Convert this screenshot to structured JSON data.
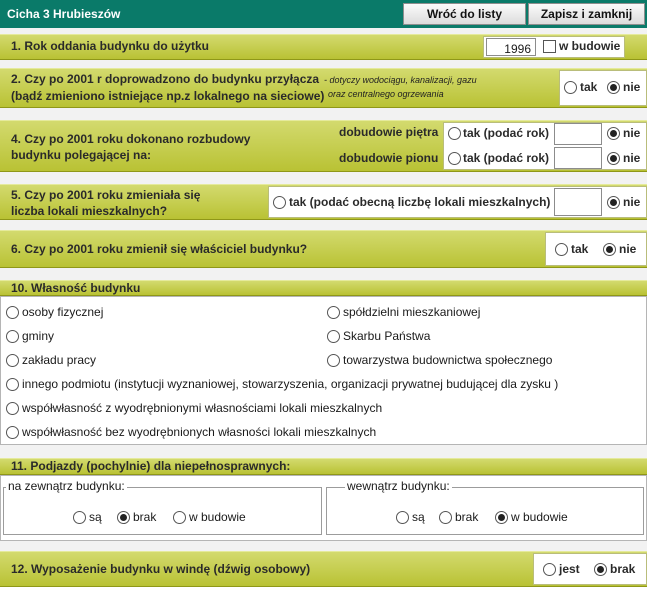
{
  "header": {
    "title": "Cicha 3  Hrubieszów",
    "back_label": "Wróć do listy",
    "save_label": "Zapisz i zamknij"
  },
  "q1": {
    "label": "1. Rok oddania budynku do użytku",
    "year": "1996",
    "under_construction_label": "w budowie",
    "under_construction_checked": false
  },
  "q2": {
    "line1": "2. Czy po 2001 r doprowadzono do budynku przyłącza",
    "line2": "(bądź zmieniono istniejące np.z lokalnego na sieciowe)",
    "note1": "- dotyczy wodociągu, kanalizacji, gazu",
    "note2": "oraz centralnego ogrzewania",
    "yes": "tak",
    "no": "nie",
    "selected": "nie"
  },
  "q4": {
    "line1": "4. Czy po 2001 roku dokonano rozbudowy",
    "line2": "budynku polegającej na:",
    "floor_label": "dobudowie piętra",
    "vertical_label": "dobudowie pionu",
    "yes": "tak (podać rok)",
    "no": "nie",
    "floor_selected": "nie",
    "vertical_selected": "nie",
    "floor_year": "",
    "vertical_year": ""
  },
  "q5": {
    "line1": "5. Czy po 2001 roku zmieniała się",
    "line2": "liczba lokali mieszkalnych?",
    "yes": "tak (podać obecną liczbę lokali mieszkalnych)",
    "no": "nie",
    "selected": "nie",
    "count": ""
  },
  "q6": {
    "label": "6. Czy po 2001 roku zmienił się właściciel budynku?",
    "yes": "tak",
    "no": "nie",
    "selected": "nie"
  },
  "q10": {
    "label": "10. Własność budynku",
    "options": [
      "osoby fizycznej",
      "spółdzielni mieszkaniowej",
      "gminy",
      "Skarbu Państwa",
      "zakładu pracy",
      "towarzystwa budownictwa społecznego",
      "innego podmiotu (instytucji wyznaniowej, stowarzyszenia, organizacji prywatnej budującej dla zysku )",
      "współwłasność z wyodrębnionymi własnościami lokali mieszkalnych",
      "współwłasność bez wyodrębnionych własności lokali mieszkalnych"
    ]
  },
  "q11": {
    "label": "11. Podjazdy (pochylnie) dla niepełnosprawnych:",
    "outside": {
      "legend": "na zewnątrz budynku:",
      "options": [
        "są",
        "brak",
        "w budowie"
      ],
      "selected": "brak"
    },
    "inside": {
      "legend": "wewnątrz budynku:",
      "options": [
        "są",
        "brak",
        "w budowie"
      ],
      "selected": "w budowie"
    }
  },
  "q12": {
    "label": "12. Wyposażenie budynku w windę (dźwig osobowy)",
    "yes": "jest",
    "no": "brak",
    "selected": "brak"
  }
}
